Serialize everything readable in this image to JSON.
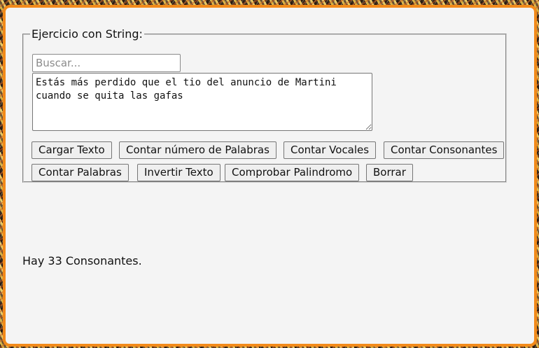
{
  "exercise": {
    "legend": "Ejercicio con String:",
    "search_placeholder": "Buscar...",
    "text": "Estás más perdido que el tio del anuncio de Martini cuando se quita las gafas"
  },
  "buttons": {
    "cargar_texto": "Cargar Texto",
    "contar_numero_palabras": "Contar número de Palabras",
    "contar_vocales": "Contar Vocales",
    "contar_consonantes": "Contar Consonantes",
    "contar_palabras": "Contar Palabras",
    "invertir_texto": "Invertir Texto",
    "comprobar_palindromo": "Comprobar Palindromo",
    "borrar": "Borrar"
  },
  "result": {
    "text": "Hay 33 Consonantes."
  },
  "colors": {
    "frame_border": "#f28a1a",
    "panel_background": "#f4f4f4"
  }
}
